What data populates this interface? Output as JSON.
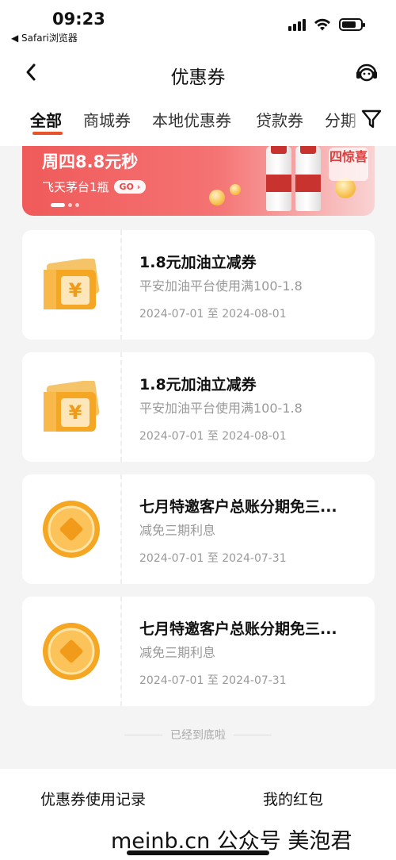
{
  "status_bar": {
    "time": "09:23",
    "back_app": "◀ Safari浏览器"
  },
  "nav": {
    "title": "优惠券",
    "back_icon": "chevron-left-icon",
    "service_icon": "customer-service-icon"
  },
  "tabs": [
    {
      "label": "全部",
      "active": true
    },
    {
      "label": "商城券",
      "active": false
    },
    {
      "label": "本地优惠券",
      "active": false
    },
    {
      "label": "贷款券",
      "active": false
    },
    {
      "label": "分期",
      "active": false
    }
  ],
  "filter_icon": "filter-icon",
  "banner": {
    "title": "周四8.8元秒",
    "subtitle": "飞天茅台1瓶",
    "go_label": "GO",
    "badge": "四惊喜"
  },
  "coupons": [
    {
      "icon": "ticket-icon",
      "title": "1.8元加油立减券",
      "desc": "平安加油平台使用满100-1.8",
      "date": "2024-07-01 至 2024-08-01"
    },
    {
      "icon": "ticket-icon",
      "title": "1.8元加油立减券",
      "desc": "平安加油平台使用满100-1.8",
      "date": "2024-07-01 至 2024-08-01"
    },
    {
      "icon": "coin-icon",
      "title": "七月特邀客户总账分期免三...",
      "desc": "减免三期利息",
      "date": "2024-07-01 至 2024-07-31"
    },
    {
      "icon": "coin-icon",
      "title": "七月特邀客户总账分期免三...",
      "desc": "减免三期利息",
      "date": "2024-07-01 至 2024-07-31"
    }
  ],
  "end_note": "已经到底啦",
  "bottom": {
    "records_label": "优惠券使用记录",
    "red_packet_label": "我的红包"
  },
  "watermark": "meinb.cn 公众号 美泡君",
  "colors": {
    "accent": "#e8532a",
    "banner": "#f05a5a",
    "coupon_icon": "#f5a623"
  }
}
